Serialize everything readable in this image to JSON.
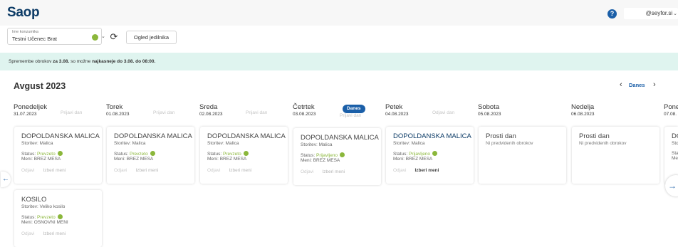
{
  "header": {
    "logo": "Saop",
    "help_icon": "?",
    "user_menu": "@seyfor.si"
  },
  "toolbar": {
    "user_label": "Ime konzumika",
    "user_value": "Testni Učenec Brat",
    "menu_button": "Ogled jedilnika"
  },
  "notice": {
    "part1": "Spremembe obrokov ",
    "bold1": "za 3.08.",
    "part2": " so možne ",
    "bold2": "najkasneje do 3.08. do 08:00."
  },
  "calendar": {
    "month": "Avgust 2023",
    "today_label": "Danes",
    "prev_icon": "‹",
    "next_icon": "›",
    "days": [
      {
        "name": "Ponedeljek",
        "date": "31.07.2023",
        "action": "Prijavi dan"
      },
      {
        "name": "Torek",
        "date": "01.08.2023",
        "action": "Prijavi dan"
      },
      {
        "name": "Sreda",
        "date": "02.08.2023",
        "action": "Prijavi dan"
      },
      {
        "name": "Četrtek",
        "date": "03.08.2023",
        "action": "Prijavi dan",
        "badge": "Danes"
      },
      {
        "name": "Petek",
        "date": "04.08.2023",
        "action": "Odjavi dan"
      },
      {
        "name": "Sobota",
        "date": "05.08.2023"
      },
      {
        "name": "Nedelja",
        "date": "06.08.2023"
      },
      {
        "name": "Pone",
        "date": "07.08."
      }
    ]
  },
  "labels": {
    "status": "Status: ",
    "menu": "Meni: ",
    "odjavi": "Odjavi",
    "izberi": "Izberi meni"
  },
  "meals": {
    "mon_malica": {
      "title": "DOPOLDANSKA MALICA",
      "service": "Storitev: Malica",
      "status": "Prevzeto",
      "menu": "BREZ MESA"
    },
    "mon_kosilo": {
      "title": "KOSILO",
      "service": "Storitev: Veliko kosilo",
      "status": "Prevzeto",
      "menu": "OSNOVNI MENI"
    },
    "tue_malica": {
      "title": "DOPOLDANSKA MALICA",
      "service": "Storitev: Malica",
      "status": "Prevzeto",
      "menu": "BREZ MESA"
    },
    "wed_malica": {
      "title": "DOPOLDANSKA MALICA",
      "service": "Storitev: Malica",
      "status": "Prevzeto",
      "menu": "BREZ MESA"
    },
    "thu_malica": {
      "title": "DOPOLDANSKA MALICA",
      "service": "Storitev: Malica",
      "status": "Prijavljeno",
      "menu": "BREZ MESA"
    },
    "fri_malica": {
      "title": "DOPOLDANSKA MALICA",
      "service": "Storitev: Malica",
      "status": "Prijavljeno",
      "menu": "BREZ MESA"
    },
    "next_mon": {
      "title": "DO",
      "service": "Sto",
      "status": "Sta",
      "menu": "Me"
    }
  },
  "free_days": {
    "sat": {
      "title": "Prosti dan",
      "text": "Ni predvidenih obrokov"
    },
    "sun": {
      "title": "Prosti dan",
      "text": "Ni predvidenih obrokov"
    }
  },
  "colors": {
    "brand": "#0c3b66",
    "accent": "#1b5fa8",
    "status_ok": "#8bb73b",
    "notice_bg": "#dff4ef"
  },
  "icons": {
    "refresh": "refresh-icon",
    "scroll_left": "arrow-left-icon",
    "scroll_right": "arrow-right-icon"
  }
}
